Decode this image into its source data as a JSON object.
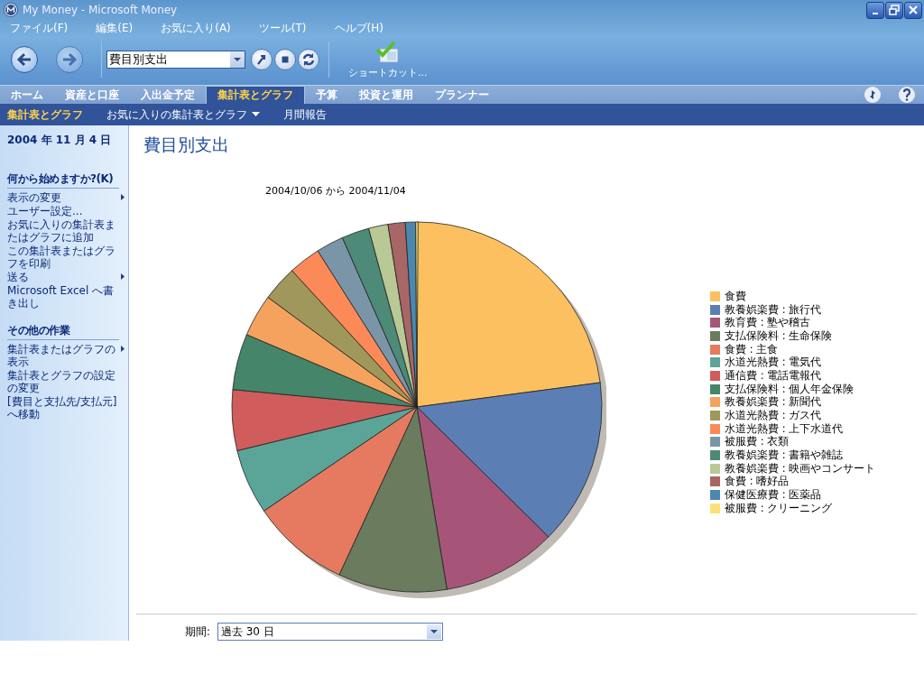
{
  "window": {
    "title": "My Money - Microsoft Money"
  },
  "menu": [
    "ファイル(F)",
    "編集(E)",
    "お気に入り(A)",
    "ツール(T)",
    "ヘルプ(H)"
  ],
  "toolbar": {
    "address": "費目別支出",
    "shortcut_label": "ショートカット..."
  },
  "tabs": [
    {
      "label": "ホーム",
      "selected": false
    },
    {
      "label": "資産と口座",
      "selected": false
    },
    {
      "label": "入出金予定",
      "selected": false
    },
    {
      "label": "集計表とグラフ",
      "selected": true
    },
    {
      "label": "予算",
      "selected": false
    },
    {
      "label": "投資と運用",
      "selected": false
    },
    {
      "label": "プランナー",
      "selected": false
    }
  ],
  "subtabs": [
    {
      "label": "集計表とグラフ",
      "selected": true,
      "dropdown": false
    },
    {
      "label": "お気に入りの集計表とグラフ",
      "selected": false,
      "dropdown": true
    },
    {
      "label": "月間報告",
      "selected": false,
      "dropdown": false
    }
  ],
  "sidebar": {
    "date": "2004 年 11 月 4 日",
    "sections": [
      {
        "heading": "何から始めますか?(K)",
        "items": [
          {
            "label": "表示の変更",
            "submenu": true
          },
          {
            "label": "ユーザー設定...",
            "submenu": false
          },
          {
            "label": "お気に入りの集計表またはグラフに追加",
            "submenu": false
          },
          {
            "label": "この集計表またはグラフを印刷",
            "submenu": false
          },
          {
            "label": "送る",
            "submenu": true
          },
          {
            "label": "Microsoft Excel へ書き出し",
            "submenu": false
          }
        ]
      },
      {
        "heading": "その他の作業",
        "items": [
          {
            "label": "集計表またはグラフの表示",
            "submenu": true
          },
          {
            "label": "集計表とグラフの設定の変更",
            "submenu": false
          },
          {
            "label": "[費目と支払先/支払元] へ移動",
            "submenu": false
          }
        ]
      }
    ]
  },
  "report": {
    "title": "費目別支出",
    "date_range": "2004/10/06 から 2004/11/04",
    "legend": [
      {
        "label": "食費",
        "color": "#fdc060"
      },
      {
        "label": "教養娯楽費 : 旅行代",
        "color": "#5b7fb5"
      },
      {
        "label": "教育費 : 塾や稽古",
        "color": "#a65579"
      },
      {
        "label": "支払保険料 : 生命保険",
        "color": "#6b7b5e"
      },
      {
        "label": "食費 : 主食",
        "color": "#e57a60"
      },
      {
        "label": "水道光熱費 : 電気代",
        "color": "#5aa598"
      },
      {
        "label": "通信費 : 電話電報代",
        "color": "#d05c5c"
      },
      {
        "label": "支払保険料 : 個人年金保険",
        "color": "#45866a"
      },
      {
        "label": "教養娯楽費 : 新聞代",
        "color": "#f5a25e"
      },
      {
        "label": "水道光熱費 : ガス代",
        "color": "#a0975a"
      },
      {
        "label": "水道光熱費 : 上下水道代",
        "color": "#fb8a58"
      },
      {
        "label": "被服費 : 衣類",
        "color": "#7b95a8"
      },
      {
        "label": "教養娯楽費 : 書籍や雑誌",
        "color": "#4d8a78"
      },
      {
        "label": "教養娯楽費 : 映画やコンサート",
        "color": "#b8c995"
      },
      {
        "label": "食費 : 嗜好品",
        "color": "#a86666"
      },
      {
        "label": "保健医療費 : 医薬品",
        "color": "#4a88b0"
      },
      {
        "label": "被服費 : クリーニング",
        "color": "#fde07a"
      }
    ],
    "period_label": "期間:",
    "period_value": "過去 30 日"
  }
}
